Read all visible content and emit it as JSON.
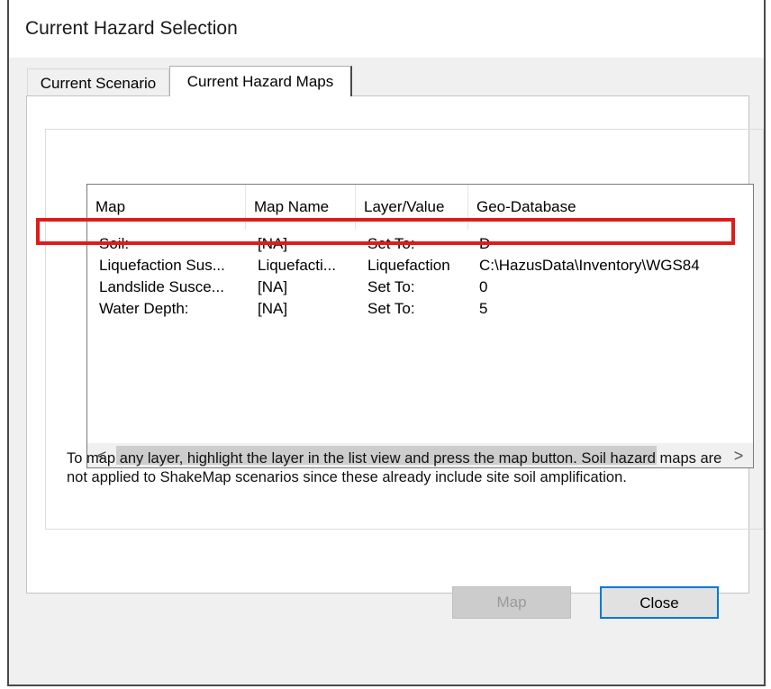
{
  "window": {
    "title": "Current Hazard Selection"
  },
  "tabs": [
    {
      "label": "Current Scenario",
      "active": false
    },
    {
      "label": "Current Hazard Maps",
      "active": true
    }
  ],
  "list": {
    "columns": [
      "Map",
      "Map Name",
      "Layer/Value",
      "Geo-Database"
    ],
    "rows": [
      [
        "Soil:",
        "[NA]",
        "Set To:",
        "D"
      ],
      [
        "Liquefaction Sus...",
        "Liquefacti...",
        "Liquefaction",
        "C:\\HazusData\\Inventory\\WGS84"
      ],
      [
        "Landslide Susce...",
        "[NA]",
        "Set To:",
        "0"
      ],
      [
        "Water Depth:",
        "[NA]",
        "Set To:",
        "5"
      ]
    ],
    "selected_row": 1
  },
  "scrollbar": {
    "left_icon": "chevron-left-icon",
    "right_icon": "chevron-right-icon",
    "left_glyph": "<",
    "right_glyph": ">"
  },
  "info_text": "To map any layer, highlight the layer in the list view and press the map button. Soil hazard maps are not applied to ShakeMap scenarios since these already include site soil amplification.",
  "buttons": {
    "map": "Map",
    "close": "Close"
  },
  "colors": {
    "highlight_border": "#e01b1b",
    "default_button_border": "#0078d7"
  }
}
